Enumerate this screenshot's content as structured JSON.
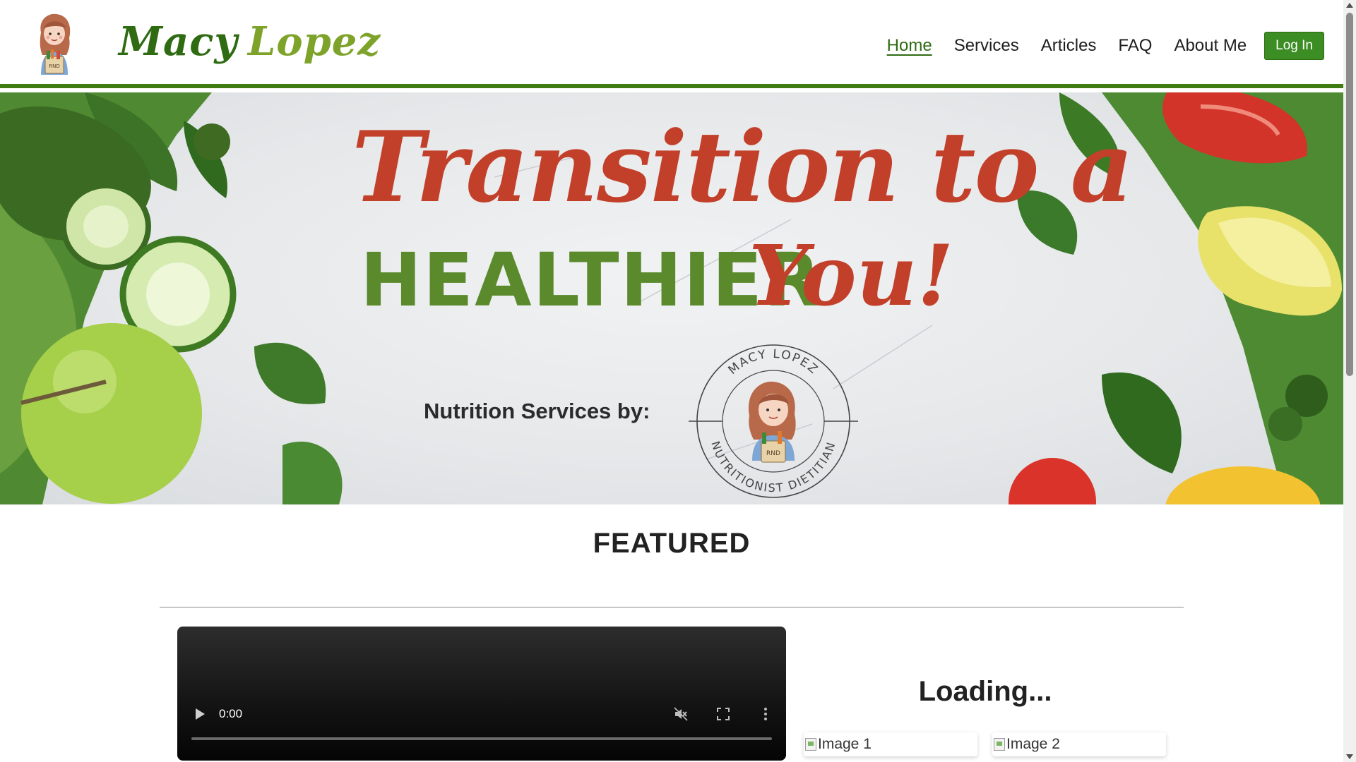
{
  "header": {
    "brand_first": "Macy",
    "brand_last": "Lopez",
    "nav": [
      {
        "label": "Home",
        "active": true
      },
      {
        "label": "Services",
        "active": false
      },
      {
        "label": "Articles",
        "active": false
      },
      {
        "label": "FAQ",
        "active": false
      },
      {
        "label": "About Me",
        "active": false
      }
    ],
    "login_label": "Log In",
    "accent_color": "#3f7d12"
  },
  "hero": {
    "line1": "Transition to a",
    "line2_a": "HEALTHIER",
    "line2_b": "You!",
    "subtitle": "Nutrition Services by:",
    "seal_top_text": "MACY LOPEZ",
    "seal_bottom_text": "NUTRITIONIST DIETITIAN",
    "seal_badge": "RND",
    "title_color": "#c2402a",
    "green_color": "#5a8a2c"
  },
  "featured": {
    "title": "FEATURED",
    "video": {
      "time": "0:00",
      "play_icon": "play-icon",
      "mute_icon": "muted-speaker-icon",
      "fullscreen_icon": "fullscreen-icon",
      "menu_icon": "kebab-menu-icon"
    },
    "loading_text": "Loading...",
    "images": [
      {
        "alt": "Image 1"
      },
      {
        "alt": "Image 2"
      }
    ]
  }
}
